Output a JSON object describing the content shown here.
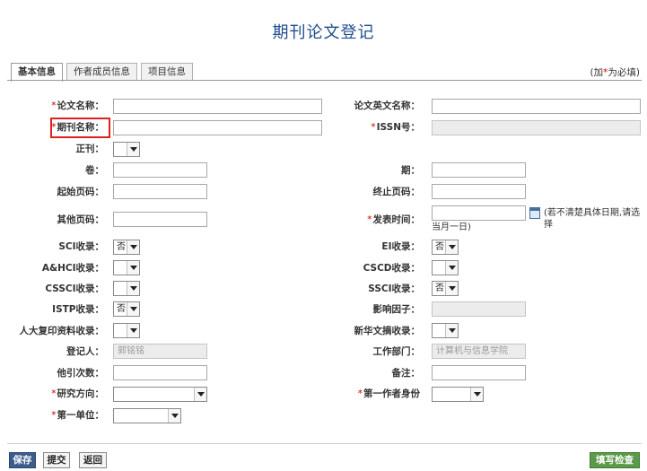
{
  "page": {
    "title": "期刊论文登记"
  },
  "tabs": [
    {
      "label": "基本信息"
    },
    {
      "label": "作者成员信息"
    },
    {
      "label": "项目信息"
    }
  ],
  "required_note": {
    "prefix": "(加",
    "star": "*",
    "suffix": "为必填)"
  },
  "required_mark": "*",
  "fields": {
    "paper_title": {
      "label": "论文名称：",
      "value": ""
    },
    "paper_title_en": {
      "label": "论文英文名称：",
      "value": ""
    },
    "journal_name": {
      "label": "期刊名称：",
      "value": ""
    },
    "issn": {
      "label": "ISSN号：",
      "value": ""
    },
    "zhengkan": {
      "label": "正刊：",
      "value": ""
    },
    "volume": {
      "label": "卷：",
      "value": ""
    },
    "issue": {
      "label": "期：",
      "value": ""
    },
    "start_page": {
      "label": "起始页码：",
      "value": ""
    },
    "end_page": {
      "label": "终止页码：",
      "value": ""
    },
    "other_page": {
      "label": "其他页码：",
      "value": ""
    },
    "publish_time": {
      "label": "发表时间：",
      "value": "",
      "hint_line1": "(若不清楚具体日期,请选择",
      "hint_line2": "当月一日)"
    },
    "sci": {
      "label": "SCI收录：",
      "value": "否"
    },
    "ei": {
      "label": "EI收录：",
      "value": "否"
    },
    "ahci": {
      "label": "A&HCI收录：",
      "value": ""
    },
    "cscd": {
      "label": "CSCD收录：",
      "value": ""
    },
    "cssci": {
      "label": "CSSCI收录：",
      "value": ""
    },
    "ssci": {
      "label": "SSCI收录：",
      "value": "否"
    },
    "istp": {
      "label": "ISTP收录：",
      "value": "否"
    },
    "impact": {
      "label": "影响因子：",
      "value": ""
    },
    "rdfy": {
      "label": "人大复印资料收录：",
      "value": ""
    },
    "xinhua": {
      "label": "新华文摘收录：",
      "value": ""
    },
    "registrant": {
      "label": "登记人：",
      "value": "郭铭铭"
    },
    "department": {
      "label": "工作部门：",
      "value": "计算机与信息学院"
    },
    "citations": {
      "label": "他引次数：",
      "value": ""
    },
    "remarks": {
      "label": "备注：",
      "value": ""
    },
    "research_direction": {
      "label": "研究方向：",
      "value": ""
    },
    "first_author_identity": {
      "label": "第一作者身份",
      "value": ""
    },
    "first_unit": {
      "label": "第一单位：",
      "value": ""
    }
  },
  "buttons": {
    "save": "保存",
    "submit": "提交",
    "back": "返回",
    "check": "填写检查"
  }
}
